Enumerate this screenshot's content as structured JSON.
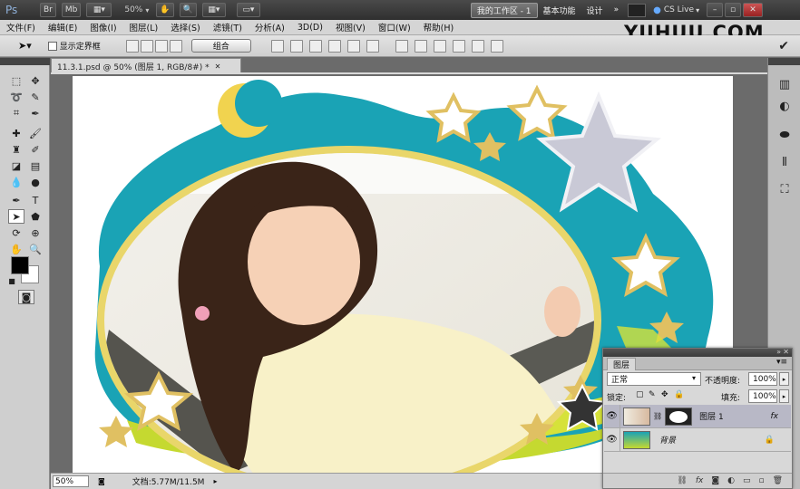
{
  "appbar": {
    "ps_logo": "Ps",
    "br_label": "Br",
    "mb_label": "Mb",
    "zoom": "50%",
    "workspace_active": "我的工作区 - 1",
    "workspace_basic": "基本功能",
    "workspace_design": "设计",
    "overflow": "»",
    "cslive": "CS Live"
  },
  "watermark": "YIIHUU.COM",
  "menu": [
    "文件(F)",
    "编辑(E)",
    "图像(I)",
    "图层(L)",
    "选择(S)",
    "滤镜(T)",
    "分析(A)",
    "3D(D)",
    "视图(V)",
    "窗口(W)",
    "帮助(H)"
  ],
  "options": {
    "show_transform": "显示定界框",
    "combine_button": "组合"
  },
  "document": {
    "tab_title": "11.3.1.psd @ 50% (图层 1, RGB/8#) *",
    "zoom": "50%",
    "doc_size": "文档:5.77M/11.5M"
  },
  "layers_panel": {
    "tab": "图层",
    "blend_mode": "正常",
    "opacity_label": "不透明度:",
    "opacity_value": "100%",
    "lock_label": "锁定:",
    "fill_label": "填充:",
    "fill_value": "100%",
    "layers": [
      {
        "name": "图层 1",
        "selected": true
      },
      {
        "name": "背景",
        "selected": false
      }
    ],
    "fx": "fx"
  },
  "colors": {
    "frame_teal": "#1aa3b5",
    "frame_lime": "#c5d930",
    "star_gold": "#e0c062",
    "selection": "#c9c9d6"
  }
}
